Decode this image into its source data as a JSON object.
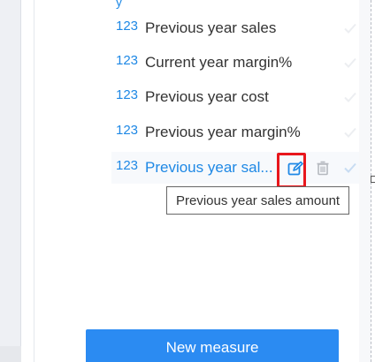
{
  "fields": [
    {
      "type": "123",
      "name": "Previous year sales"
    },
    {
      "type": "123",
      "name": "Current year margin%"
    },
    {
      "type": "123",
      "name": "Previous year cost"
    },
    {
      "type": "123",
      "name": "Previous year margin%"
    },
    {
      "type": "123",
      "name": "Previous year sal..."
    }
  ],
  "tooltip": {
    "text": "Previous year sales amount"
  },
  "actions": {
    "new_measure_label": "New measure"
  },
  "icons": {
    "edit": "edit-icon",
    "delete": "trash-icon",
    "check": "check-icon"
  },
  "colors": {
    "accent": "#1e88e5",
    "button": "#2b8bf2",
    "highlight": "#e8161c"
  }
}
